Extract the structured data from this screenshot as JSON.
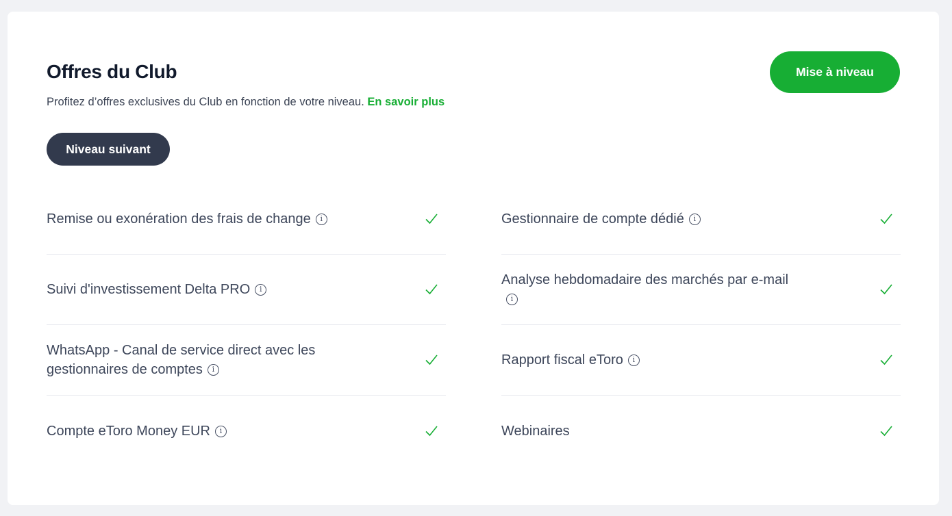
{
  "header": {
    "title": "Offres du Club",
    "subtitle": "Profitez d’offres exclusives du Club en fonction de votre niveau.",
    "learn_more": "En savoir plus",
    "upgrade_button": "Mise à niveau",
    "next_level_button": "Niveau suivant"
  },
  "benefits": {
    "left": [
      {
        "label": "Remise ou exonération des frais de change",
        "info": true,
        "included": true
      },
      {
        "label": "Suivi d'investissement Delta PRO",
        "info": true,
        "included": true
      },
      {
        "label": "WhatsApp - Canal de service direct avec les gestionnaires de comptes",
        "info": true,
        "included": true
      },
      {
        "label": "Compte eToro Money EUR",
        "info": true,
        "included": true
      }
    ],
    "right": [
      {
        "label": "Gestionnaire de compte dédié",
        "info": true,
        "included": true
      },
      {
        "label": "Analyse hebdomadaire des marchés par e-mail",
        "info": true,
        "included": true
      },
      {
        "label": "Rapport fiscal eToro",
        "info": true,
        "included": true
      },
      {
        "label": "Webinaires",
        "info": false,
        "included": true
      }
    ]
  },
  "icons": {
    "info": "info-icon",
    "check": "checkmark-icon"
  },
  "colors": {
    "accent": "#17ae34",
    "dark_button": "#323a4d",
    "title": "#111a2c"
  }
}
